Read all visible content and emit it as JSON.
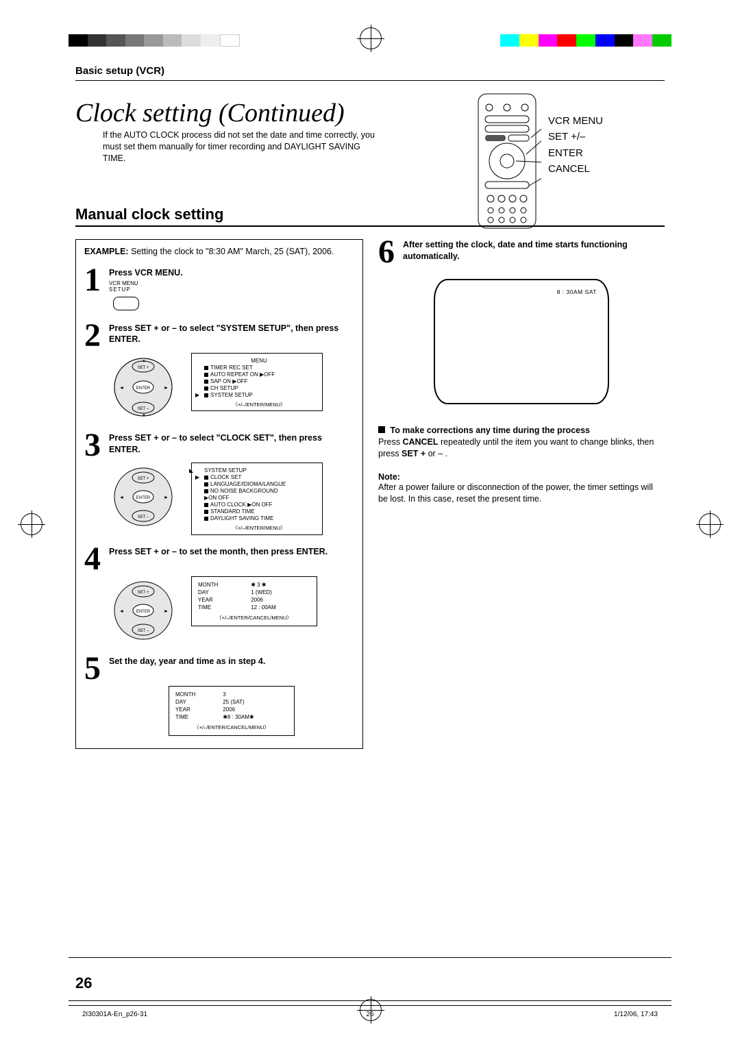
{
  "header": {
    "section": "Basic setup (VCR)"
  },
  "title": "Clock setting (Continued)",
  "intro": "If the AUTO CLOCK process did not set the date and time correctly, you must set them manually for timer recording and DAYLIGHT SAVING TIME.",
  "remote_labels": {
    "l1": "VCR MENU",
    "l2": "SET +/–",
    "l3": "ENTER",
    "l4": "CANCEL"
  },
  "subheading": "Manual clock setting",
  "example": {
    "label": "EXAMPLE:",
    "text": "Setting the clock to \"8:30 AM\" March, 25 (SAT), 2006."
  },
  "step1": {
    "text": "Press VCR MENU.",
    "key_label_top": "VCR MENU",
    "key_label_bottom": "SETUP"
  },
  "step2": {
    "text": "Press SET + or – to select \"SYSTEM SETUP\", then press ENTER.",
    "osd": {
      "title": "MENU",
      "items": [
        "TIMER REC SET",
        "AUTO REPEAT   ON  ▶OFF",
        "SAP                    ON  ▶OFF",
        "CH SETUP",
        "SYSTEM SETUP"
      ],
      "hint": "〈+/–/ENTER/MENU〉"
    }
  },
  "step3": {
    "text": "Press SET + or – to select \"CLOCK SET\", then press ENTER.",
    "osd": {
      "title": "SYSTEM SETUP",
      "items": [
        "CLOCK SET",
        "LANGUAGE/IDIOMA/LANGUE",
        "NO NOISE BACKGROUND",
        "                           ▶ON   OFF",
        "AUTO CLOCK   ▶ON   OFF",
        "STANDARD TIME",
        "DAYLIGHT SAVING TIME"
      ],
      "hint": "〈+/–/ENTER/MENU〉"
    }
  },
  "step4": {
    "text": "Press SET + or – to set the month, then press ENTER.",
    "osd": {
      "rows": [
        [
          "MONTH",
          "✱ 3 ✱"
        ],
        [
          "DAY",
          "1 (WED)"
        ],
        [
          "YEAR",
          "2006"
        ],
        [
          "TIME",
          "12 : 00AM"
        ]
      ],
      "hint": "〈+/–/ENTER/CANCEL/MENU〉"
    }
  },
  "step5": {
    "text": "Set the day, year and time as in step 4.",
    "osd": {
      "rows": [
        [
          "MONTH",
          "3"
        ],
        [
          "DAY",
          "25 (SAT)"
        ],
        [
          "YEAR",
          "2006"
        ],
        [
          "TIME",
          "✱8 : 30AM✱"
        ]
      ],
      "hint": "〈+/–/ENTER/CANCEL/MENU〉"
    }
  },
  "step6": {
    "text": "After setting the clock, date and time starts functioning automatically.",
    "tv_text": "8 : 30AM   SAT"
  },
  "corrections": {
    "heading": "To make corrections any time during the process",
    "body_pre": "Press ",
    "body_bold1": "CANCEL",
    "body_mid": " repeatedly until the item you want to change blinks, then press ",
    "body_bold2": "SET + ",
    "body_post": "or – ."
  },
  "note": {
    "heading": "Note:",
    "body": "After a power failure or disconnection of the power, the timer settings will be lost. In this case, reset the present time."
  },
  "page_number": "26",
  "footer": {
    "left": "2I30301A-En_p26-31",
    "center": "26",
    "right": "1/12/06, 17:43"
  }
}
